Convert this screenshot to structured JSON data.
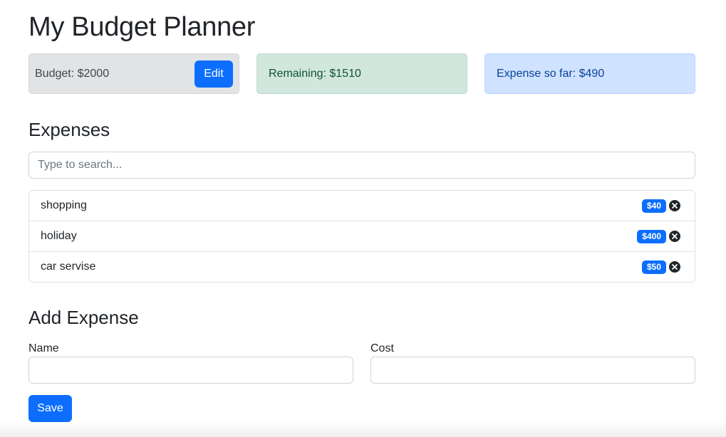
{
  "header": {
    "title": "My Budget Planner"
  },
  "summary": {
    "budget_text": "Budget: $2000",
    "edit_label": "Edit",
    "remaining_text": "Remaining: $1510",
    "spent_text": "Expense so far: $490"
  },
  "expenses": {
    "heading": "Expenses",
    "search_placeholder": "Type to search...",
    "items": [
      {
        "name": "shopping",
        "cost": "$40"
      },
      {
        "name": "holiday",
        "cost": "$400"
      },
      {
        "name": "car servise",
        "cost": "$50"
      }
    ]
  },
  "add_form": {
    "heading": "Add Expense",
    "name_label": "Name",
    "cost_label": "Cost",
    "name_value": "",
    "cost_value": "",
    "save_label": "Save"
  },
  "colors": {
    "primary": "#0d6efd",
    "budget_bg": "#e2e3e5",
    "remaining_bg": "#d1e7dd",
    "spent_bg": "#cfe2ff"
  },
  "icons": {
    "delete": "close-circle-icon"
  }
}
